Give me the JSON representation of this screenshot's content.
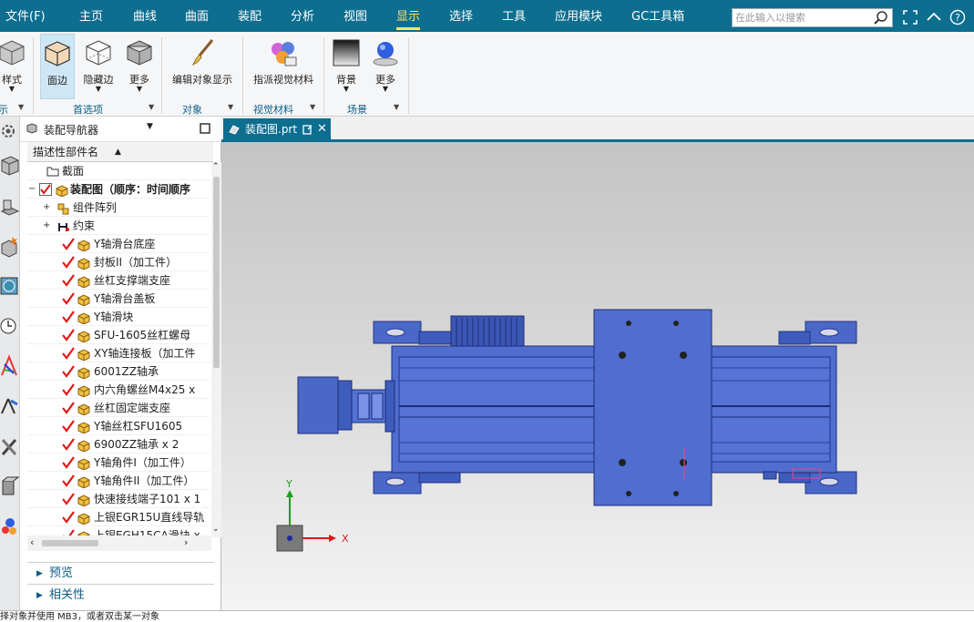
{
  "menu": {
    "file": "文件(F)",
    "items": [
      "主页",
      "曲线",
      "曲面",
      "装配",
      "分析",
      "视图",
      "显示",
      "选择",
      "工具",
      "应用模块",
      "GC工具箱"
    ],
    "active_index": 6
  },
  "search": {
    "placeholder": "在此输入以搜索"
  },
  "ribbon": {
    "buttons": {
      "style": "样式",
      "face_edge": "面边",
      "hidden_edge": "隐藏边",
      "more1": "更多",
      "edit_display": "编辑对象显示",
      "assign_material": "指派视觉材料",
      "background": "背景",
      "more2": "更多"
    },
    "groups": {
      "display": "示",
      "preferences": "首选项",
      "object": "对象",
      "visual_material": "视觉材料",
      "scene": "场景"
    }
  },
  "navigator": {
    "title": "装配导航器",
    "column_header": "描述性部件名",
    "tree": [
      {
        "label": "截面",
        "kind": "folder",
        "indent": 1
      },
      {
        "label": "装配图（顺序：时间顺序",
        "kind": "root",
        "indent": 1,
        "bold": true
      },
      {
        "label": "组件阵列",
        "kind": "array",
        "indent": 2
      },
      {
        "label": "约束",
        "kind": "constraint",
        "indent": 2
      },
      {
        "label": "Y轴滑台底座",
        "kind": "part"
      },
      {
        "label": "封板II（加工件）",
        "kind": "part"
      },
      {
        "label": "丝杠支撑端支座",
        "kind": "part"
      },
      {
        "label": "Y轴滑台盖板",
        "kind": "part"
      },
      {
        "label": "Y轴滑块",
        "kind": "part"
      },
      {
        "label": "SFU-1605丝杠螺母",
        "kind": "part"
      },
      {
        "label": "XY轴连接板（加工件",
        "kind": "part"
      },
      {
        "label": "6001ZZ轴承",
        "kind": "part"
      },
      {
        "label": "内六角螺丝M4x25 x",
        "kind": "part"
      },
      {
        "label": "丝杠固定端支座",
        "kind": "part"
      },
      {
        "label": "Y轴丝杠SFU1605",
        "kind": "part"
      },
      {
        "label": "6900ZZ轴承 x 2",
        "kind": "part"
      },
      {
        "label": "Y轴角件I（加工件）",
        "kind": "part"
      },
      {
        "label": "Y轴角件II（加工件）",
        "kind": "part"
      },
      {
        "label": "快速接线端子101 x 1",
        "kind": "part"
      },
      {
        "label": "上银EGR15U直线导轨",
        "kind": "part"
      },
      {
        "label": "上银EGH15CA滑块 x",
        "kind": "part"
      }
    ],
    "sections": [
      "预览",
      "相关性"
    ]
  },
  "tab": {
    "label": "装配图.prt"
  },
  "axes": {
    "y": "Y",
    "x": "X"
  },
  "status": "择对象并使用 MB3，或者双击某一对象",
  "colors": {
    "menubar": "#0d6e8f",
    "active_menu": "#ffe36b",
    "part_blue": "#4a68c8",
    "check_red": "#e01818"
  }
}
